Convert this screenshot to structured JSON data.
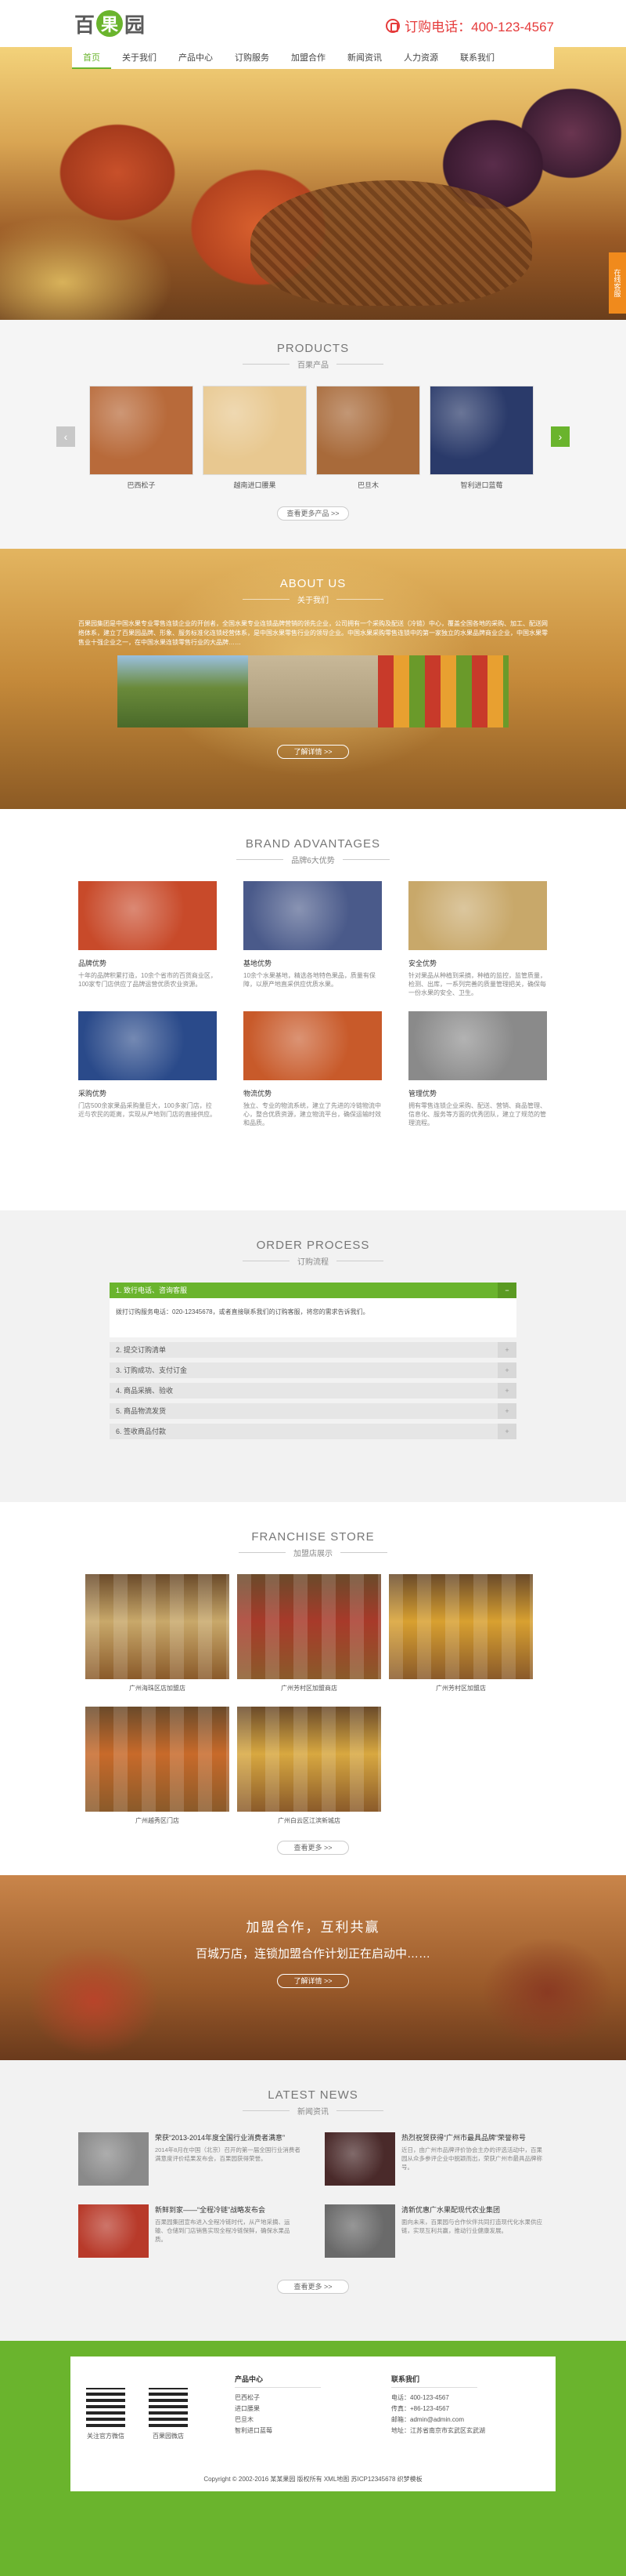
{
  "header": {
    "logo_text_1": "百",
    "logo_text_2": "果",
    "logo_text_3": "园",
    "hotline": "订购电话：400-123-4567"
  },
  "nav": [
    "首页",
    "关于我们",
    "产品中心",
    "订购服务",
    "加盟合作",
    "新闻资讯",
    "人力资源",
    "联系我们"
  ],
  "side_tab": "在线客服",
  "products": {
    "en": "PRODUCTS",
    "cn": "百果产品",
    "items": [
      {
        "caption": "巴西松子",
        "color": "#b86a3a"
      },
      {
        "caption": "越南进口腰果",
        "color": "#e8c890"
      },
      {
        "caption": "巴旦木",
        "color": "#a86a3a"
      },
      {
        "caption": "智利进口蓝莓",
        "color": "#2a3a6a"
      }
    ],
    "more": "查看更多产品 >>"
  },
  "about": {
    "en": "ABOUT US",
    "cn": "关于我们",
    "text": "百果园集团是中国水果专业零售连锁企业的开创者，全国水果专业连锁品牌营销的领先企业，公司拥有一个采购及配送（冷链）中心，覆盖全国各地的采购、加工、配送网络体系，建立了百果园品牌、形象、服务标准化连锁经营体系，是中国水果零售行业的领导企业。中国水果采购零售连锁中的第一家独立的水果品牌商业企业，中国水果零售业十强企业之一，在中国水果连锁零售行业的大品牌……",
    "button": "了解详情 >>"
  },
  "advantages": {
    "en": "BRAND ADVANTAGES",
    "cn": "品牌6大优势",
    "items": [
      {
        "title": "品牌优势",
        "desc": "十年的品牌积累打造，10余个省市的百货商业区，100家专门店供应了品牌运营优质农业资源。",
        "color": "#c84a2a"
      },
      {
        "title": "基地优势",
        "desc": "10余个水果基地，精选各地特色果品，质量有保障，以原产地直采供应优质水果。",
        "color": "#4a5a8a"
      },
      {
        "title": "安全优势",
        "desc": "针对果品从种植到采摘，种植的监控，监管质量，检测、出库，一系列完善的质量管理把关，确保每一份水果的安全、卫生。",
        "color": "#c8a86a"
      },
      {
        "title": "采购优势",
        "desc": "门店500余家果品采购量巨大，100多家门店，拉近与农民的距离，实现从产地到门店的直接供应。",
        "color": "#2a4a8a"
      },
      {
        "title": "物流优势",
        "desc": "独立、专业的物流系统，建立了先进的冷链物流中心，整合优质资源，建立物流平台，确保运输时效和品质。",
        "color": "#c85a2a"
      },
      {
        "title": "管理优势",
        "desc": "拥有零售连锁企业采购、配送、营销、商品管理、信息化、服务等方面的优秀团队，建立了规范的管理流程。",
        "color": "#8a8a8a"
      }
    ]
  },
  "order": {
    "en": "ORDER PROCESS",
    "cn": "订购流程",
    "open_step": "1. 致行电话、咨询客服",
    "open_text": "拨打订购服务电话：020-12345678，或者直接联系我们的订购客服，将您的需求告诉我们。",
    "steps": [
      "2. 提交订购清单",
      "3. 订购成功、支付订金",
      "4. 商品采摘、验收",
      "5. 商品物流发货",
      "6. 签收商品付款"
    ]
  },
  "franchise": {
    "en": "FRANCHISE STORE",
    "cn": "加盟店展示",
    "items": [
      {
        "caption": "广州海珠区店加盟店",
        "color": "#c8a86a"
      },
      {
        "caption": "广州芳村区加盟商店",
        "color": "#a83a2a"
      },
      {
        "caption": "广州芳村区加盟店",
        "color": "#d8a030"
      },
      {
        "caption": "广州越秀区门店",
        "color": "#c86a2a"
      },
      {
        "caption": "广州白云区江滨新城店",
        "color": "#d8a840"
      }
    ],
    "more": "查看更多 >>"
  },
  "banner": {
    "title": "加盟合作，互利共赢",
    "subtitle": "百城万店，连锁加盟合作计划正在启动中……",
    "button": "了解详情 >>"
  },
  "news": {
    "en": "LATEST NEWS",
    "cn": "新闻资讯",
    "items": [
      {
        "title": "荣获“2013-2014年度全国行业消费者满意”",
        "desc": "2014年8月在中国（北京）召开的第一届全国行业消费者满意度评价结果发布会，百果园获得荣誉。",
        "color": "#8a8a8a"
      },
      {
        "title": "热烈祝贺获得“广州市最具品牌”荣誉称号",
        "desc": "近日，由广州市品牌评价协会主办的评选活动中，百果园从众多参评企业中脱颖而出，荣获广州市最具品牌称号。",
        "color": "#4a2a2a"
      },
      {
        "title": "新鲜到家——“全程冷链”战略发布会",
        "desc": "百果园集团宣布进入全程冷链时代，从产地采摘、运输、仓储到门店销售实现全程冷链保鲜，确保水果品质。",
        "color": "#b83a2a"
      },
      {
        "title": "清新优惠广水果配现代农业集团",
        "desc": "面向未来，百果园与合作伙伴共同打造现代化水果供应链，实现互利共赢，推动行业健康发展。",
        "color": "#6a6a6a"
      }
    ],
    "more": "查看更多 >>"
  },
  "footer": {
    "qr1_label": "关注官方微信",
    "qr2_label": "百果园微店",
    "col1_title": "产品中心",
    "col1_items": [
      "巴西松子",
      "进口腰果",
      "巴旦木",
      "智利进口蓝莓"
    ],
    "col2_title": "联系我们",
    "col2_items": [
      "电话：400-123-4567",
      "传真：+86-123-4567",
      "邮箱：admin@admin.com",
      "地址：江苏省南京市玄武区玄武湖"
    ],
    "copyright": "Copyright © 2002-2016 某某果园 版权所有  XML地图  苏ICP12345678  织梦模板"
  }
}
